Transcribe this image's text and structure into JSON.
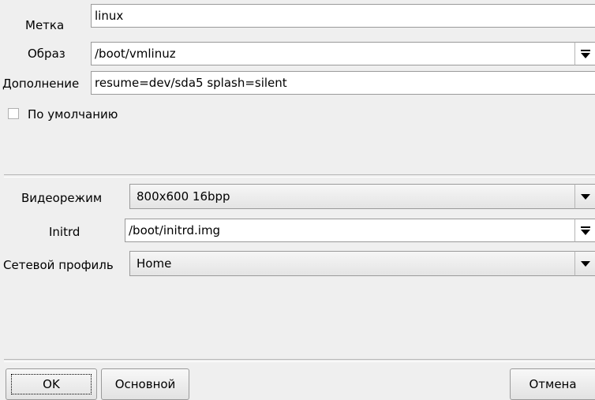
{
  "form": {
    "label_field": {
      "label": "Метка",
      "value": "linux"
    },
    "image_field": {
      "label": "Образ",
      "value": "/boot/vmlinuz"
    },
    "append_field": {
      "label": "Дополнение",
      "value": "resume=dev/sda5 splash=silent"
    },
    "default_checkbox": {
      "label": "По умолчанию",
      "checked": false
    },
    "video_mode": {
      "label": "Видеорежим",
      "value": "800x600 16bpp"
    },
    "initrd": {
      "label": "Initrd",
      "value": "/boot/initrd.img"
    },
    "network_profile": {
      "label": "Сетевой профиль",
      "value": "Home"
    }
  },
  "buttons": {
    "ok": "OK",
    "advanced": "Основной",
    "cancel": "Отмена"
  },
  "icons": {
    "combo_arrow": "triangle-down-icon",
    "combo_arrow_with_bar": "triangle-down-bar-icon"
  },
  "colors": {
    "background": "#efefef",
    "field_background": "#ffffff",
    "border": "#9a9a9a"
  }
}
